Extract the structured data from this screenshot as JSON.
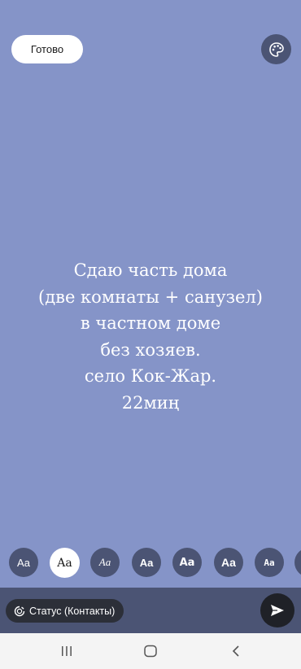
{
  "header": {
    "done_label": "Готово",
    "palette_icon": "palette-icon"
  },
  "status": {
    "lines": [
      "Сдаю часть дома",
      "(две комнаты + санузел)",
      "в частном доме",
      "без хозяев.",
      "село Кок-Жар.",
      "22миң"
    ]
  },
  "font_options": [
    "Aa",
    "Aa",
    "Aa",
    "Aa",
    "Aa",
    "Aa",
    "Aa"
  ],
  "selected_font_index": 1,
  "footer": {
    "audience_label": "Статус (Контакты)",
    "send_icon": "send-icon"
  },
  "nav": {
    "icons": [
      "recent-apps-icon",
      "home-icon",
      "back-icon"
    ]
  },
  "colors": {
    "background": "#8594c8",
    "bar": "#4b5474",
    "text": "#ffffff"
  }
}
